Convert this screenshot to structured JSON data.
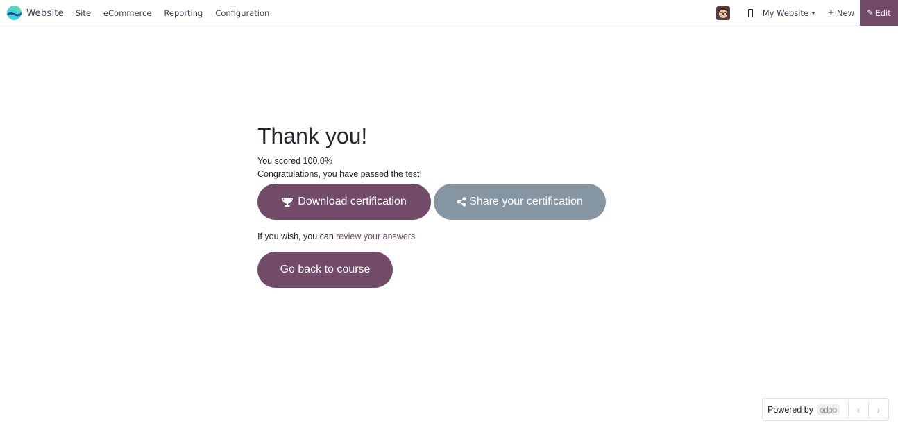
{
  "navbar": {
    "brand": "Website",
    "menu": [
      "Site",
      "eCommerce",
      "Reporting",
      "Configuration"
    ],
    "website_selector": "My Website",
    "new_label": "New",
    "edit_label": "Edit",
    "accent_color": "#714b67"
  },
  "main": {
    "title": "Thank you!",
    "score_text": "You scored 100.0%",
    "congrats_text": "Congratulations, you have passed the test!",
    "download_button": "Download certification",
    "share_button": "Share your certification",
    "review_prefix": "If you wish, you can",
    "review_link": "review your answers",
    "back_button": "Go back to course"
  },
  "footer": {
    "powered_by": "Powered by",
    "brand": "odoo"
  }
}
